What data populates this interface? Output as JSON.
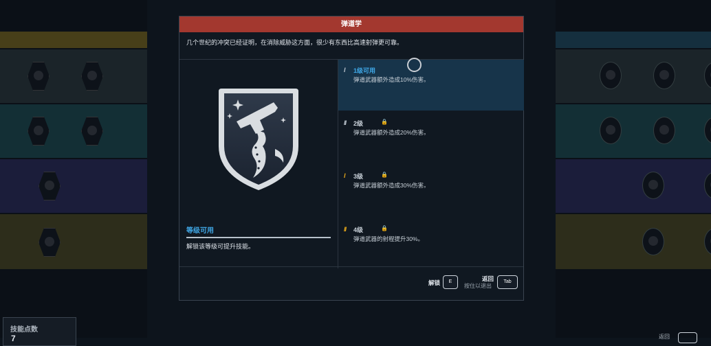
{
  "dialog": {
    "title": "弹道学",
    "description": "几个世纪的冲突已经证明，在消除威胁这方面，很少有东西比高速射弹更可靠。",
    "emblem_icon": "pistol-tentacle-shield-icon",
    "status_title": "等级可用",
    "status_text": "解锁该等级可提升技能。",
    "levels": [
      {
        "tier_mark": "I",
        "name": "1级可用",
        "desc": "弹道武器额外造成10%伤害。",
        "locked": false,
        "active": true,
        "tier_color": "#b9c2cb"
      },
      {
        "tier_mark": "II",
        "name": "2级",
        "desc": "弹道武器额外造成20%伤害。",
        "locked": true,
        "active": false,
        "tier_color": "#b9c2cb"
      },
      {
        "tier_mark": "I",
        "name": "3级",
        "desc": "弹道武器额外造成30%伤害。",
        "locked": true,
        "active": false,
        "tier_color": "#e0a31a"
      },
      {
        "tier_mark": "II",
        "name": "4级",
        "desc": "弹道武器的射程提升30%。",
        "locked": true,
        "active": false,
        "tier_color": "#e0a31a"
      }
    ],
    "footer": {
      "unlock_label": "解锁",
      "unlock_key": "E",
      "back_label": "返回",
      "back_sub": "按住以退出",
      "back_key": "Tab"
    }
  },
  "skill_points": {
    "label": "技能点数",
    "value": "7"
  },
  "corner_back_label": "返回",
  "colors": {
    "header": "#a3382f",
    "accent_blue": "#3fa6e4",
    "tier_gold": "#e0a31a"
  }
}
